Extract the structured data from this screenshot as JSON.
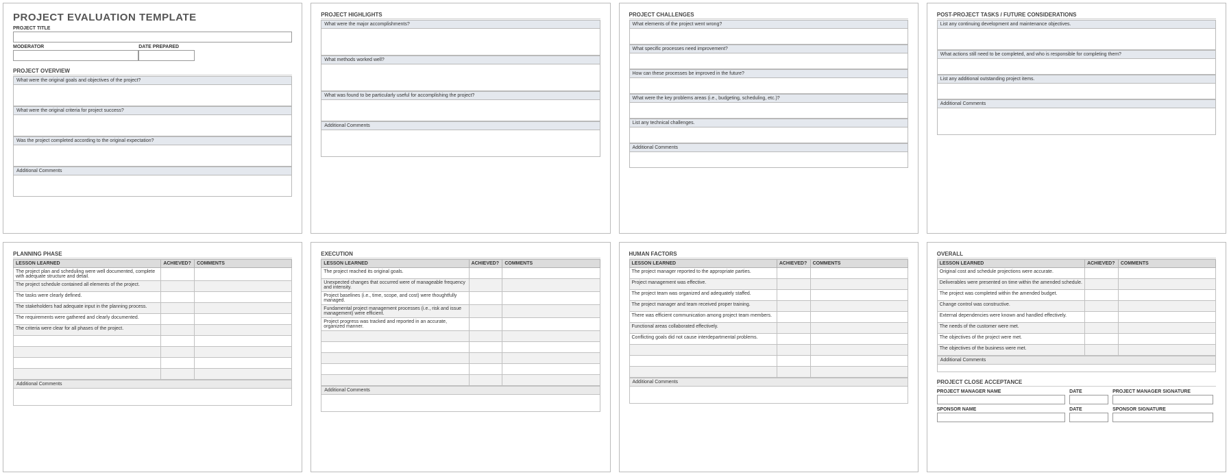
{
  "doc_title": "PROJECT EVALUATION TEMPLATE",
  "fields": {
    "project_title": "PROJECT TITLE",
    "moderator": "MODERATOR",
    "date_prepared": "DATE PREPARED"
  },
  "sections": {
    "overview": {
      "title": "PROJECT OVERVIEW",
      "q1": "What were the original goals and objectives of the project?",
      "q2": "What were the original criteria for project success?",
      "q3": "Was the project completed according to the original expectation?",
      "ac": "Additional Comments"
    },
    "highlights": {
      "title": "PROJECT HIGHLIGHTS",
      "q1": "What were the major accomplishments?",
      "q2": "What methods worked well?",
      "q3": "What was found to be particularly useful for accomplishing the project?",
      "ac": "Additional Comments"
    },
    "challenges": {
      "title": "PROJECT CHALLENGES",
      "q1": "What elements of the project went wrong?",
      "q2": "What specific processes need improvement?",
      "q3": "How can these processes be improved in the future?",
      "q4": "What were the key problems areas (i.e., budgeting, scheduling, etc.)?",
      "q5": "List any technical challenges.",
      "ac": "Additional Comments"
    },
    "postproject": {
      "title": "POST-PROJECT TASKS / FUTURE CONSIDERATIONS",
      "q1": "List any continuing development and maintenance objectives.",
      "q2": "What actions still need to be completed, and who is responsible for completing them?",
      "q3": "List any additional outstanding project items.",
      "ac": "Additional Comments"
    }
  },
  "lessons": {
    "col_lesson": "LESSON LEARNED",
    "col_achieved": "ACHIEVED?",
    "col_comments": "COMMENTS",
    "planning": {
      "title": "PLANNING PHASE",
      "rows": [
        "The project plan and scheduling were well documented, complete with adequate structure and detail.",
        "The project schedule contained all elements of the project.",
        "The tasks were clearly defined.",
        "The stakeholders had adequate input in the planning process.",
        "The requirements were gathered and clearly documented.",
        "The criteria were clear for all phases of the project.",
        "",
        "",
        "",
        ""
      ],
      "ac": "Additional Comments"
    },
    "execution": {
      "title": "EXECUTION",
      "rows": [
        "The project reached its original goals.",
        "Unexpected changes that occurred were of manageable frequency and intensity.",
        "Project baselines (i.e., time, scope, and cost) were thoughtfully managed.",
        "Fundamental project management processes (i.e., risk and issue management) were efficient.",
        "Project progress was tracked and reported in an accurate, organized manner.",
        "",
        "",
        "",
        "",
        ""
      ],
      "ac": "Additional Comments"
    },
    "human": {
      "title": "HUMAN FACTORS",
      "rows": [
        "The project manager reported to the appropriate parties.",
        "Project management was effective.",
        "The project team was organized and adequately staffed.",
        "The project manager and team received proper training.",
        "There was efficient communication among project team members.",
        "Functional areas collaborated effectively.",
        "Conflicting goals did not cause interdepartmental problems.",
        "",
        "",
        ""
      ],
      "ac": "Additional Comments"
    },
    "overall": {
      "title": "OVERALL",
      "rows": [
        "Original cost and schedule projections were accurate.",
        "Deliverables were presented on time within the amended schedule.",
        "The project was completed within the amended budget.",
        "Change control was constructive.",
        "External dependencies were known and handled effectively.",
        "The needs of the customer were met.",
        "The objectives of the project were met.",
        "The objectives of the business were met."
      ],
      "ac": "Additional Comments"
    }
  },
  "acceptance": {
    "title": "PROJECT CLOSE ACCEPTANCE",
    "pm_name": "PROJECT MANAGER NAME",
    "date": "DATE",
    "pm_sig": "PROJECT MANAGER SIGNATURE",
    "sponsor_name": "SPONSOR NAME",
    "sponsor_sig": "SPONSOR SIGNATURE"
  }
}
